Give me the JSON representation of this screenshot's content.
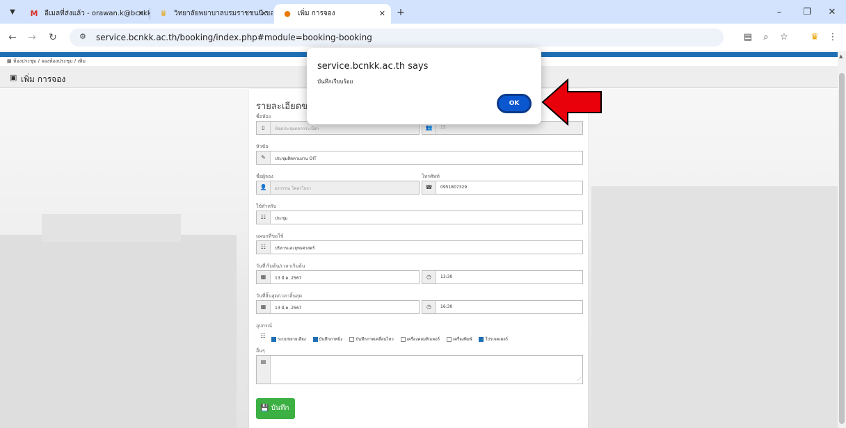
{
  "tabs": [
    {
      "favicon": "gmail-icon",
      "title": "อีเมลที่ส่งแล้ว - orawan.k@bcnkk.a",
      "active": false
    },
    {
      "favicon": "college-logo-icon",
      "title": "วิทยาลัยพยาบาลบรมราชชนนี ขอนแก่",
      "active": false
    },
    {
      "favicon": "booking-site-icon",
      "title": "เพิ่ม การจอง",
      "active": true
    }
  ],
  "address": {
    "url": "service.bcnkk.ac.th/booking/index.php#module=booking-booking"
  },
  "page": {
    "breadcrumb": "ห้องประชุม / จองห้องประชุม / เพิ่ม",
    "title": "เพิ่ม การจอง",
    "form_heading": "รายละเอียดของ"
  },
  "form": {
    "room_label": "ชื่อห้อง",
    "room_value": "ห้องประชุมดอกกระเบียก",
    "capacity_value": "15",
    "topic_label": "หัวข้อ",
    "topic_value": "ประชุมติดตามงาน OIT",
    "booker_label": "ชื่อผู้จอง",
    "booker_value": "อรวรรณ โคตรโยธา",
    "phone_label": "โทรศัพท์",
    "phone_value": "0951807329",
    "use_label": "ใช้สำหรับ",
    "use_value": "ประชุม",
    "dept_label": "แผนกที่ขอใช้",
    "dept_value": "บริหารและยุทธศาสตร์",
    "start_label": "วันที่เริ่มต้น/เวลาเริ่มต้น",
    "start_date": "13 มี.ค. 2567",
    "start_time": "13:30",
    "end_label": "วันที่สิ้นสุด/เวลาสิ้นสุด",
    "end_date": "13 มี.ค. 2567",
    "end_time": "16:30",
    "equip_label": "อุปกรณ์",
    "equipment": [
      {
        "label": "ระบบขยายเสียง",
        "checked": true
      },
      {
        "label": "บันทึกภาพนิ่ง",
        "checked": true
      },
      {
        "label": "บันทึกภาพเคลื่อนไหว",
        "checked": false
      },
      {
        "label": "เครื่องคอมพิวเตอร์",
        "checked": false
      },
      {
        "label": "เครื่องพิมพ์",
        "checked": false
      },
      {
        "label": "โปรเจคเตอร์",
        "checked": true
      }
    ],
    "other_label": "อื่นๆ",
    "save_label": "บันทึก"
  },
  "dialog": {
    "title": "service.bcnkk.ac.th says",
    "message": "บันทึกเรียบร้อย",
    "ok_label": "OK"
  },
  "colors": {
    "accent": "#1f6fb5",
    "save_green": "#3cb043",
    "ok_blue": "#0b57d0",
    "arrow_red": "#e8000b"
  }
}
